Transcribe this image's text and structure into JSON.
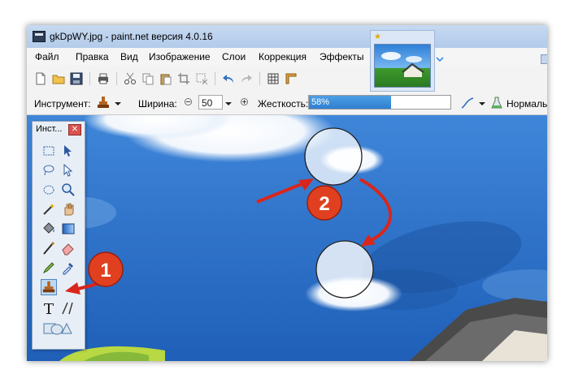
{
  "window": {
    "title": "gkDpWY.jpg - paint.net версия 4.0.16"
  },
  "menu": [
    "Файл",
    "Правка",
    "Вид",
    "Изображение",
    "Слои",
    "Коррекция",
    "Эффекты"
  ],
  "options": {
    "tool_label": "Инструмент:",
    "width_label": "Ширина:",
    "width_value": "50",
    "hardness_label": "Жесткость:",
    "hardness_value": "58%",
    "hardness_fraction": 0.58,
    "blend_label": "Нормаль"
  },
  "tools_panel": {
    "title": "Инст..."
  },
  "annotations": {
    "badge1": "1",
    "badge2": "2"
  },
  "colors": {
    "accent": "#3a8ee6",
    "annotation_red": "#d9261c",
    "badge": "#e0401f"
  }
}
